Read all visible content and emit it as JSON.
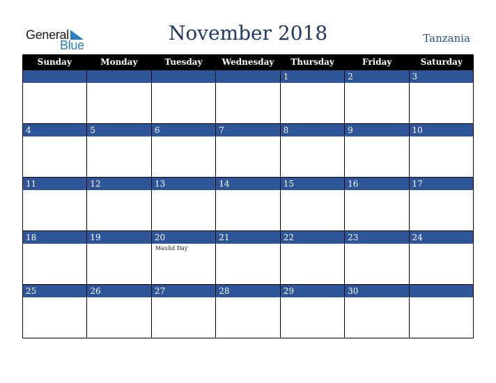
{
  "logo": {
    "line1": "General",
    "line2": "Blue",
    "icon": "triangle-flag-icon"
  },
  "header": {
    "title": "November 2018",
    "country": "Tanzania"
  },
  "colors": {
    "title": "#1f3864",
    "band": "#2d5597",
    "header_bg": "#000000",
    "logo_blue": "#2a7fc1"
  },
  "weekdays": [
    "Sunday",
    "Monday",
    "Tuesday",
    "Wednesday",
    "Thursday",
    "Friday",
    "Saturday"
  ],
  "weeks": [
    [
      {
        "date": ""
      },
      {
        "date": ""
      },
      {
        "date": ""
      },
      {
        "date": ""
      },
      {
        "date": "1"
      },
      {
        "date": "2"
      },
      {
        "date": "3"
      }
    ],
    [
      {
        "date": "4"
      },
      {
        "date": "5"
      },
      {
        "date": "6"
      },
      {
        "date": "7"
      },
      {
        "date": "8"
      },
      {
        "date": "9"
      },
      {
        "date": "10"
      }
    ],
    [
      {
        "date": "11"
      },
      {
        "date": "12"
      },
      {
        "date": "13"
      },
      {
        "date": "14"
      },
      {
        "date": "15"
      },
      {
        "date": "16"
      },
      {
        "date": "17"
      }
    ],
    [
      {
        "date": "18"
      },
      {
        "date": "19"
      },
      {
        "date": "20",
        "event": "Maulid Day"
      },
      {
        "date": "21"
      },
      {
        "date": "22"
      },
      {
        "date": "23"
      },
      {
        "date": "24"
      }
    ],
    [
      {
        "date": "25"
      },
      {
        "date": "26"
      },
      {
        "date": "27"
      },
      {
        "date": "28"
      },
      {
        "date": "29"
      },
      {
        "date": "30"
      },
      {
        "date": ""
      }
    ]
  ]
}
